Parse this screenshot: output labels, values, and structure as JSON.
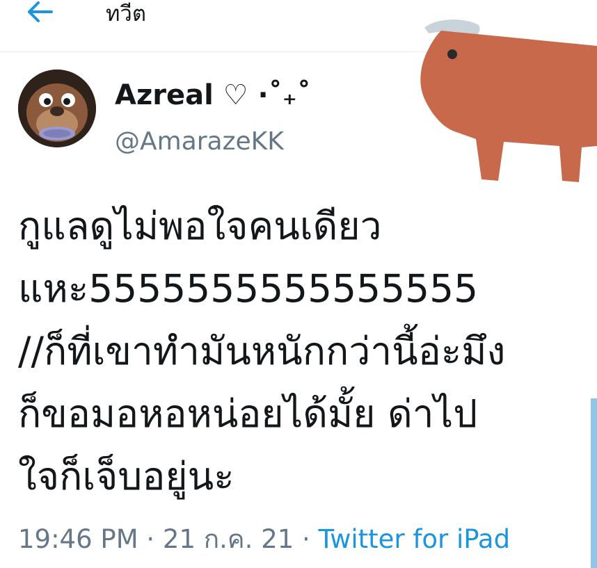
{
  "header": {
    "title": "ทวีต",
    "back_icon": "arrow-left-icon"
  },
  "tweet": {
    "display_name": "Azreal ♡ ·˚₊˚",
    "handle": "@AmarazeKK",
    "text_lines": [
      "กูแลดูไม่พอใจคนเดียว",
      "แหะ5555555555555555",
      "//ก็ที่เขาทำมันหนักกว่านี้อ่ะมึง",
      "ก็ขอมอหอหน่อยได้มั้ย ด่าไป",
      "ใจก็เจ็บอยู่นะ"
    ],
    "time": "19:46 PM",
    "separator": " · ",
    "date": "21 ก.ค. 21",
    "source": "Twitter for iPad"
  },
  "colors": {
    "accent": "#1b95e0",
    "text": "#14171a",
    "secondary": "#657786",
    "sticker_body": "#c8694c"
  },
  "sticker": {
    "icon": "ox-sticker-icon"
  }
}
